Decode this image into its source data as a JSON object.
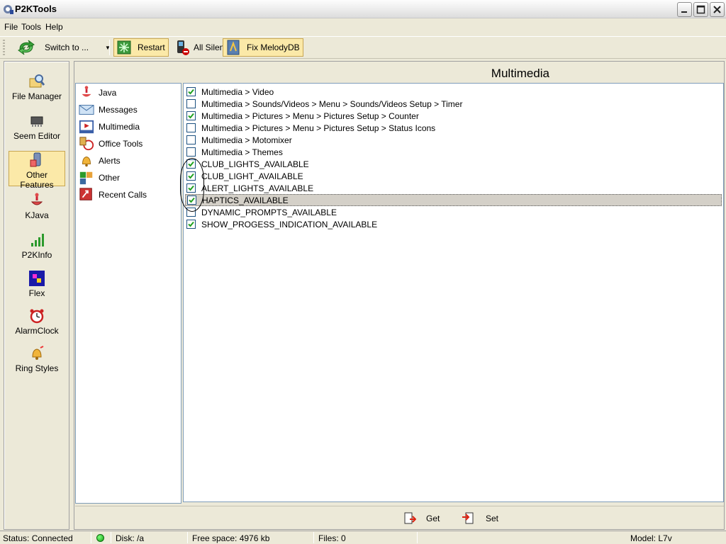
{
  "window": {
    "title": "P2KTools"
  },
  "menu": [
    "File",
    "Tools",
    "Help"
  ],
  "toolbar": {
    "switch_label": "Switch to ...",
    "restart_label": "Restart",
    "all_silent_label": "All Silent",
    "fix_melody_label": "Fix MelodyDB"
  },
  "outlookbar": {
    "items": [
      {
        "label": "File Manager",
        "icon": "magnifier-folder-icon"
      },
      {
        "label": "Seem Editor",
        "icon": "chip-icon"
      },
      {
        "label": "Other Features",
        "icon": "phone-features-icon",
        "selected": true
      },
      {
        "label": "KJava",
        "icon": "java-icon"
      },
      {
        "label": "P2KInfo",
        "icon": "signal-icon"
      },
      {
        "label": "Flex",
        "icon": "flex-icon"
      },
      {
        "label": "AlarmClock",
        "icon": "alarm-clock-icon"
      },
      {
        "label": "Ring Styles",
        "icon": "bell-icon"
      }
    ]
  },
  "content": {
    "header_title": "Multimedia",
    "categories": [
      {
        "label": "Java",
        "icon": "java-icon"
      },
      {
        "label": "Messages",
        "icon": "envelope-icon"
      },
      {
        "label": "Multimedia",
        "icon": "multimedia-icon"
      },
      {
        "label": "Office Tools",
        "icon": "office-tools-icon"
      },
      {
        "label": "Alerts",
        "icon": "bell-icon"
      },
      {
        "label": "Other",
        "icon": "puzzle-icon"
      },
      {
        "label": "Recent Calls",
        "icon": "recent-calls-icon"
      }
    ],
    "features": [
      {
        "label": "Multimedia > Video",
        "checked": true
      },
      {
        "label": "Multimedia > Sounds/Videos > Menu > Sounds/Videos Setup > Timer",
        "checked": false
      },
      {
        "label": "Multimedia > Pictures > Menu > Pictures Setup > Counter",
        "checked": true
      },
      {
        "label": "Multimedia > Pictures > Menu > Pictures Setup > Status Icons",
        "checked": false
      },
      {
        "label": "Multimedia > Motomixer",
        "checked": false
      },
      {
        "label": "Multimedia > Themes",
        "checked": false
      },
      {
        "label": "CLUB_LIGHTS_AVAILABLE",
        "checked": true
      },
      {
        "label": "CLUB_LIGHT_AVAILABLE",
        "checked": true
      },
      {
        "label": "ALERT_LIGHTS_AVAILABLE",
        "checked": true
      },
      {
        "label": "HAPTICS_AVAILABLE",
        "checked": true,
        "selected": true
      },
      {
        "label": "DYNAMIC_PROMPTS_AVAILABLE",
        "checked": false
      },
      {
        "label": "SHOW_PROGESS_INDICATION_AVAILABLE",
        "checked": true
      }
    ],
    "get_label": "Get",
    "set_label": "Set"
  },
  "statusbar": {
    "status": "Status: Connected",
    "disk": "Disk: /a",
    "free_space": "Free space: 4976 kb",
    "files": "Files: 0",
    "model": "Model: L7v",
    "connected_color": "#12a012"
  }
}
